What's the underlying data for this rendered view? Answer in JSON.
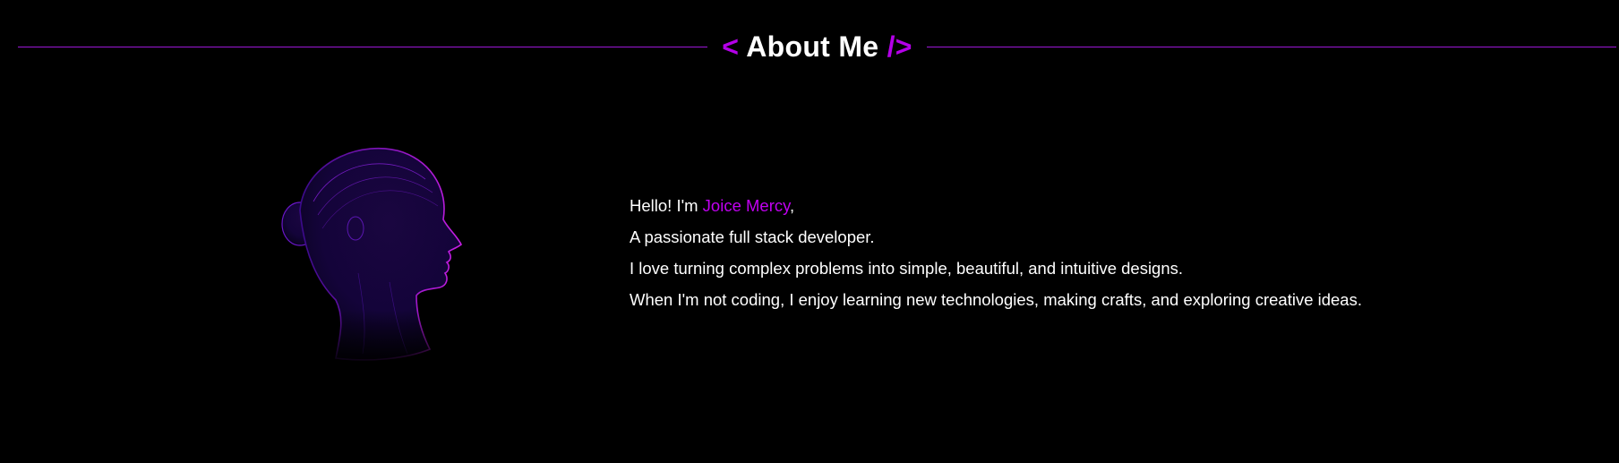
{
  "section": {
    "title_open": "<",
    "title": "About Me",
    "title_close": "/>"
  },
  "portrait": {
    "icon": "woman-profile-silhouette-icon"
  },
  "bio": {
    "greeting_prefix": "Hello! I'm ",
    "name": "Joice Mercy",
    "greeting_suffix": ",",
    "line2": "A passionate full stack developer.",
    "line3": "I love turning complex problems into simple, beautiful, and intuitive designs.",
    "line4": "When I'm not coding, I enjoy learning new technologies, making crafts, and exploring creative ideas."
  },
  "colors": {
    "background": "#000000",
    "accent": "#b400e8",
    "text": "#ffffff",
    "divider": "#9b16d6"
  }
}
